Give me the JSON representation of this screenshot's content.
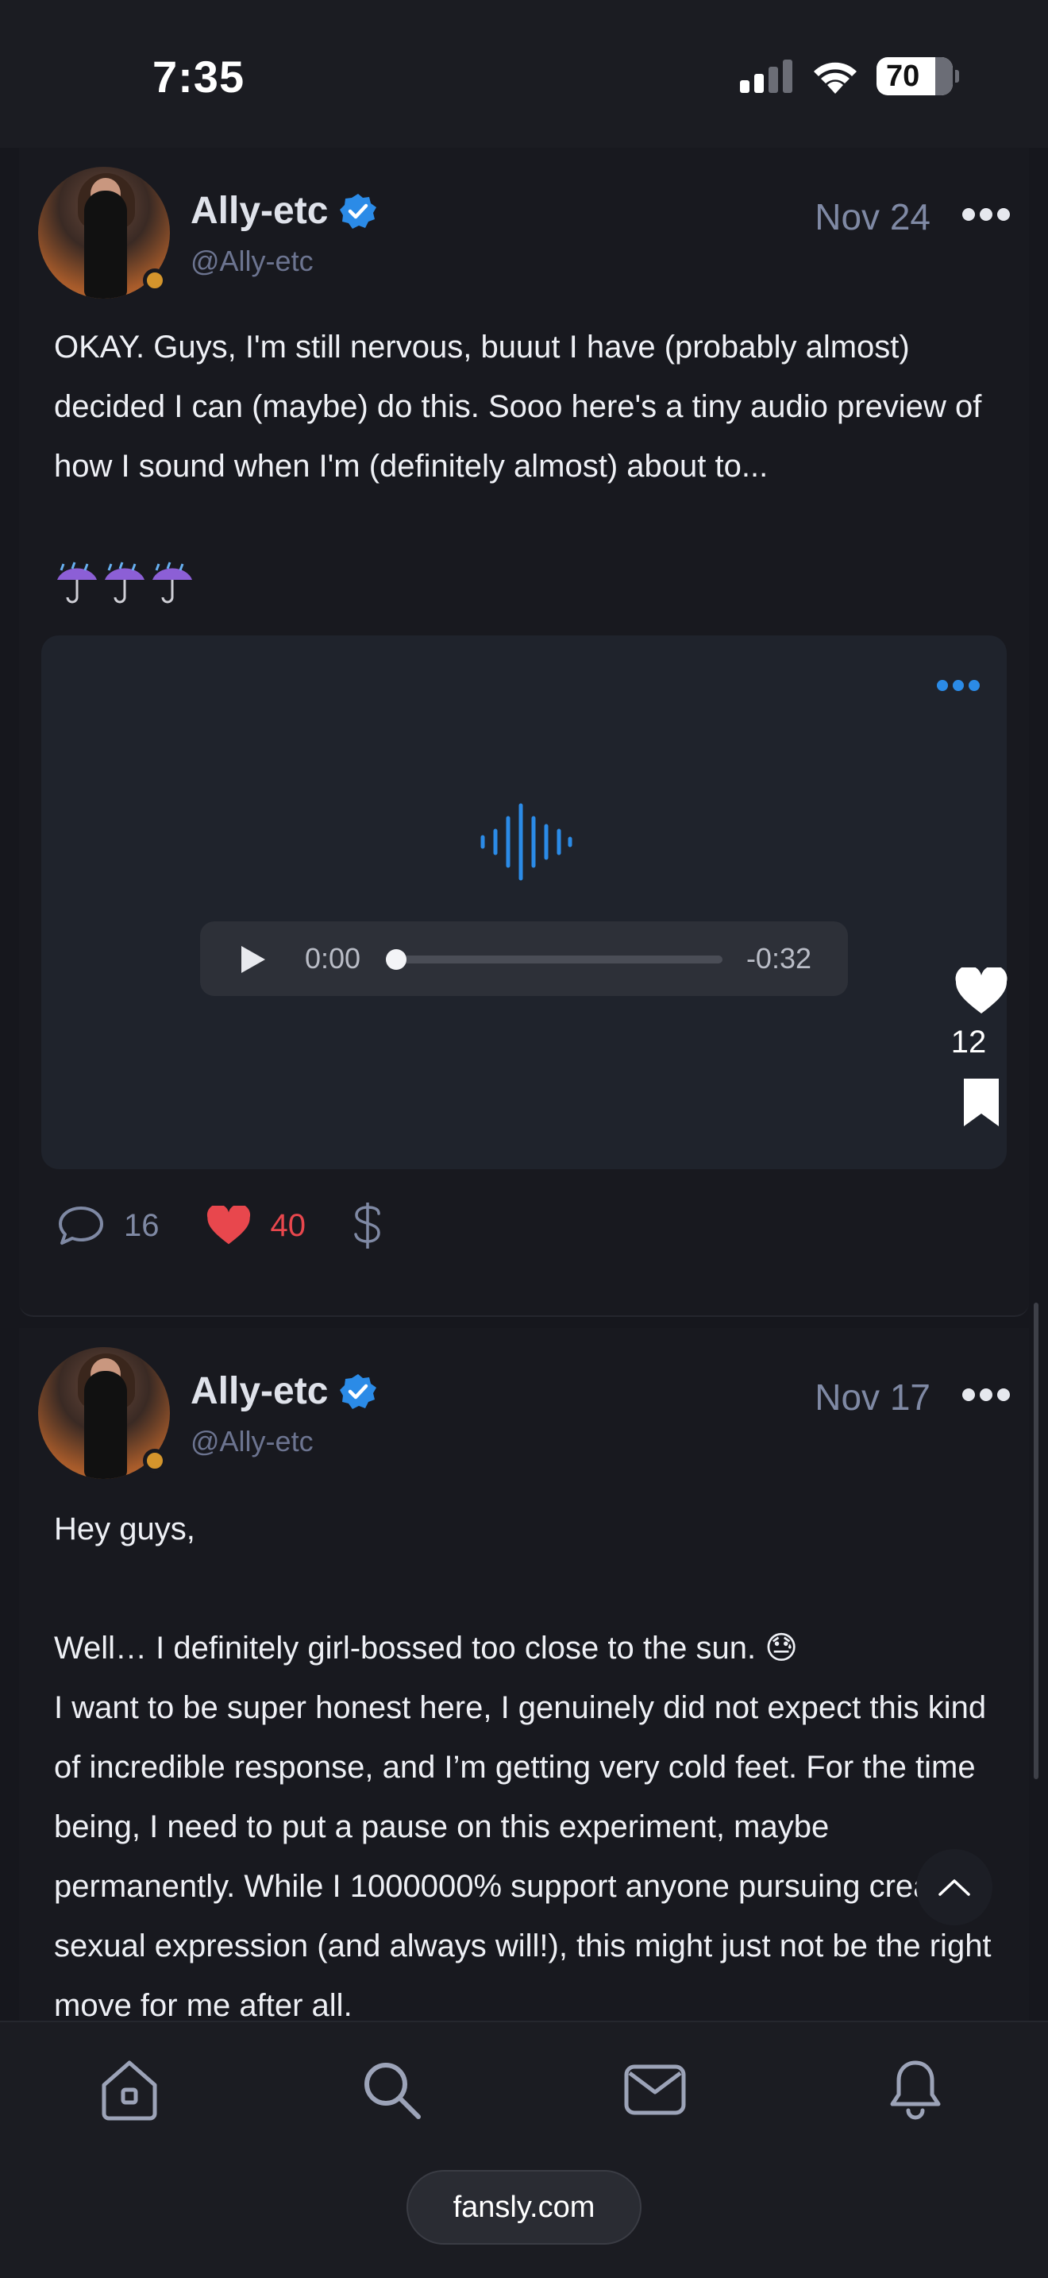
{
  "status_bar": {
    "time": "7:35",
    "battery": "70"
  },
  "posts": [
    {
      "display_name": "Ally-etc",
      "handle": "@Ally-etc",
      "date": "Nov 24",
      "text": "OKAY. Guys, I'm still nervous, buuut I have (probably almost) decided I can (maybe) do this. Sooo here's a tiny audio preview of how I sound when I'm (definitely almost) about to...",
      "emoji": "☔☔☔",
      "audio": {
        "time_elapsed": "0:00",
        "time_remaining": "-0:32",
        "progress": 0.0
      },
      "media_like_count": "12",
      "comment_count": "16",
      "like_count": "40",
      "tip_icon": "dollar-icon"
    },
    {
      "display_name": "Ally-etc",
      "handle": "@Ally-etc",
      "date": "Nov 17",
      "text": "Hey guys,\n\nWell… I definitely girl-bossed too close to the sun. 😓\nI want to be super honest here, I genuinely did not expect this kind of incredible response, and I’m getting very cold feet. For the time being, I need to put a pause on this experiment, maybe permanently. While I 1000000% support anyone pursuing creative sexual expression (and always will!), this might just not be the right move for me after all."
    }
  ],
  "bottom_nav": {
    "items": [
      "home-icon",
      "search-icon",
      "messages-icon",
      "notifications-icon"
    ],
    "url": "fansly.com"
  },
  "colors": {
    "accent_blue": "#2b8be7",
    "like_red": "#e8474d",
    "background": "#16171d"
  }
}
